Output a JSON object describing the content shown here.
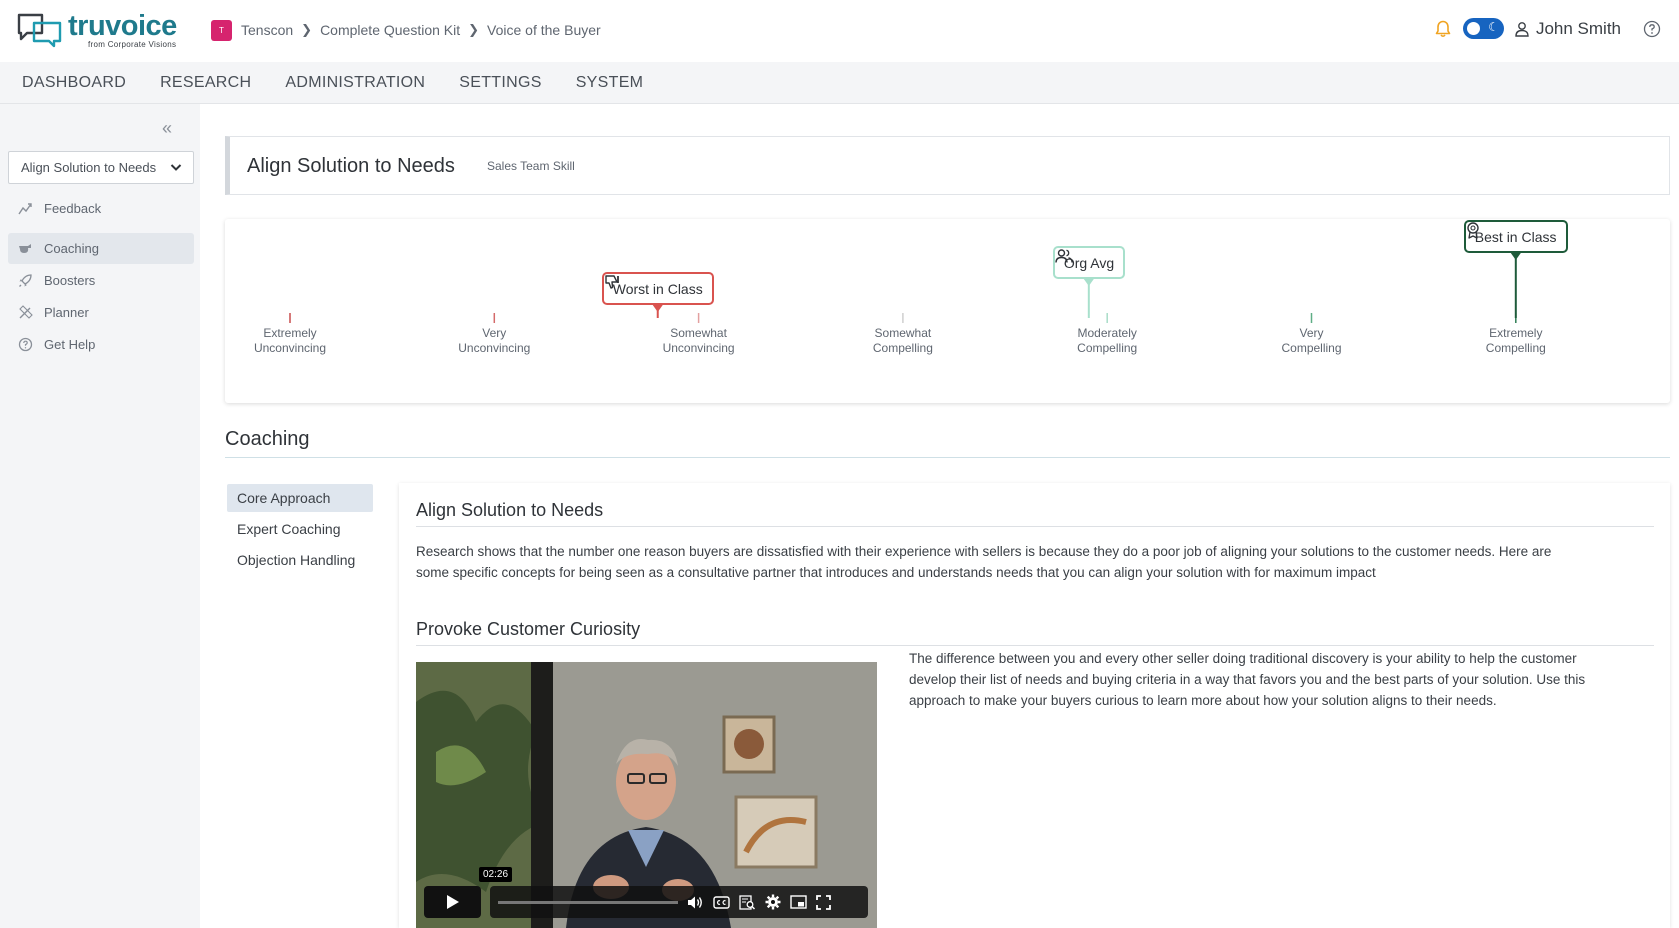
{
  "app": {
    "brand": "truvoice",
    "brand_sub": "from Corporate Visions"
  },
  "breadcrumb": {
    "org_initial": "T",
    "items": [
      "Tenscon",
      "Complete Question Kit",
      "Voice of the Buyer"
    ]
  },
  "user": {
    "name": "John Smith"
  },
  "colors": {
    "accent": "#1f7a8c",
    "worst": "#d9534f",
    "org_avg": "#a8e0cc",
    "best": "#1e5b3a",
    "toggle": "#1764c0"
  },
  "nav": [
    "DASHBOARD",
    "RESEARCH",
    "ADMINISTRATION",
    "SETTINGS",
    "SYSTEM"
  ],
  "sidebar": {
    "selected_skill": "Align Solution to Needs",
    "items": [
      {
        "label": "Feedback",
        "icon": "chart-line-icon"
      },
      {
        "label": "Coaching",
        "icon": "whistle-icon"
      },
      {
        "label": "Boosters",
        "icon": "rocket-icon"
      },
      {
        "label": "Planner",
        "icon": "pen-ruler-icon"
      },
      {
        "label": "Get Help",
        "icon": "question-circle-icon"
      }
    ],
    "active_index": 1
  },
  "page": {
    "title": "Align Solution to Needs",
    "subtitle": "Sales Team Skill"
  },
  "scale": {
    "levels": [
      [
        "Extremely",
        "Unconvincing"
      ],
      [
        "Very",
        "Unconvincing"
      ],
      [
        "Somewhat",
        "Unconvincing"
      ],
      [
        "Somewhat",
        "Compelling"
      ],
      [
        "Moderately",
        "Compelling"
      ],
      [
        "Very",
        "Compelling"
      ],
      [
        "Extremely",
        "Compelling"
      ]
    ],
    "markers": {
      "worst": {
        "label": "Worst in Class",
        "level_index": 1.8
      },
      "org": {
        "label": "Org Avg",
        "level_index": 3.91
      },
      "best": {
        "label": "Best in Class",
        "level_index": 6
      }
    }
  },
  "coaching": {
    "section_title": "Coaching",
    "tabs": [
      "Core Approach",
      "Expert Coaching",
      "Objection Handling"
    ],
    "active_tab": 0,
    "heading": "Align Solution to Needs",
    "intro_line1": "Research shows that the number one reason buyers are dissatisfied with their experience with sellers is because they do a poor job of aligning your solutions to the customer needs. Here are",
    "intro_line2": "some specific concepts for being seen as a consultative partner that introduces and understands needs that you can align your solution with for maximum impact",
    "sub_heading": "Provoke Customer Curiosity",
    "body_line1": "The difference between you and every other seller doing traditional discovery is your ability to help the customer",
    "body_line2": "develop their list of needs and buying criteria in a way that favors you and the best parts of your solution. Use this",
    "body_line3": "approach to make your buyers curious to learn more about how your solution aligns to their needs.",
    "video": {
      "time": "02:26",
      "progress": 0.0
    }
  }
}
